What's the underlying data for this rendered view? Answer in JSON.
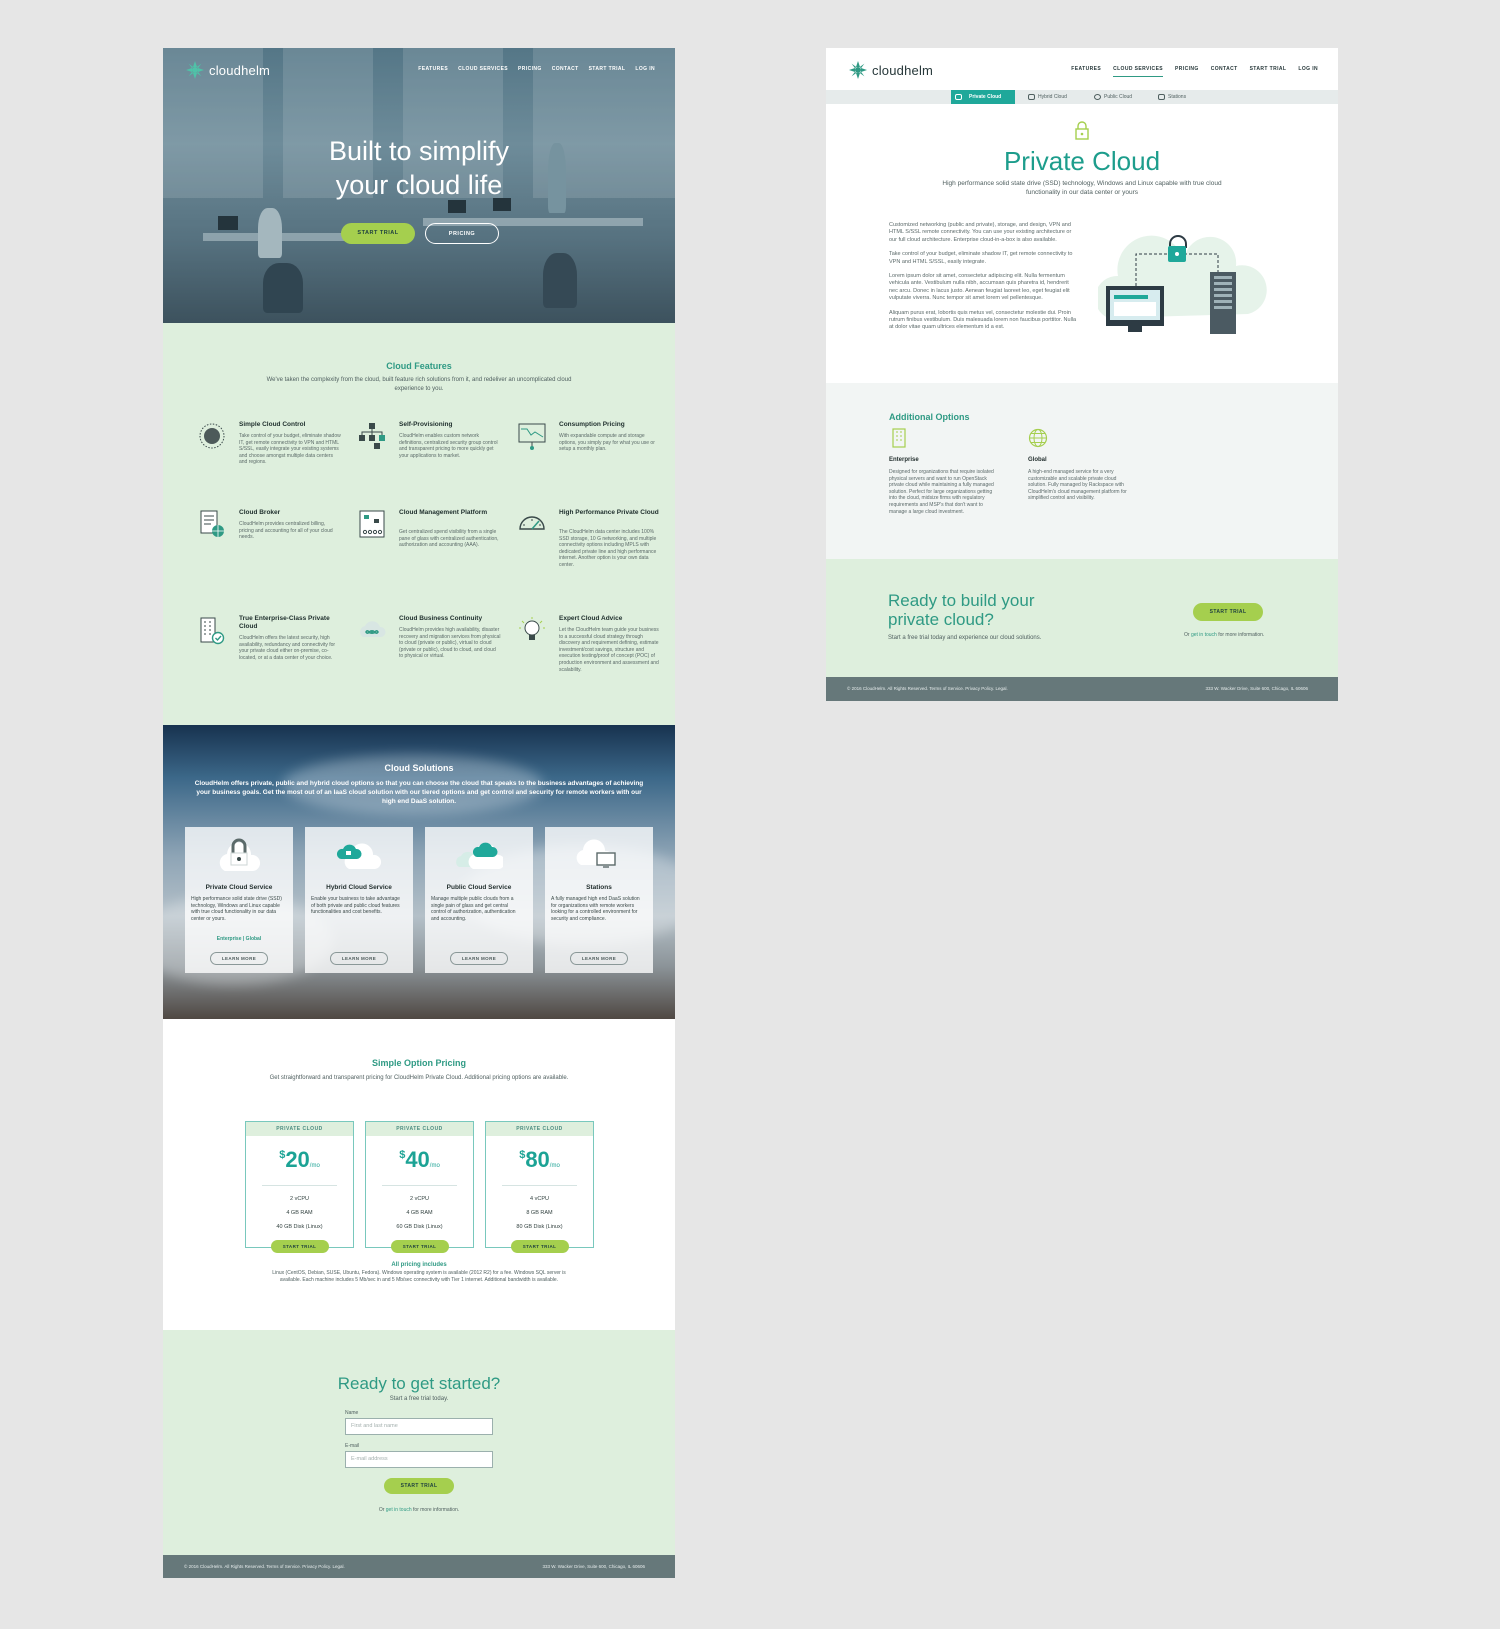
{
  "brand": {
    "name": "cloudhelm",
    "primary_color": "#2f9a84",
    "accent_color": "#a5cf4e",
    "mint_bg": "#deefdd"
  },
  "nav": [
    "FEATURES",
    "CLOUD SERVICES",
    "PRICING",
    "CONTACT",
    "START TRIAL",
    "LOG IN"
  ],
  "home": {
    "hero": {
      "title": "Built to simplify your cloud life",
      "primary_button": "START TRIAL",
      "secondary_button": "PRICING"
    },
    "features": {
      "title": "Cloud Features",
      "subtitle": "We've taken the complexity from the cloud, built feature rich solutions from it, and redeliver an uncomplicated cloud experience to you.",
      "items": [
        {
          "title": "Simple Cloud Control",
          "icon": "dial-icon",
          "desc": "Take control of your budget, eliminate shadow IT, get remote connectivity to VPN and HTML S/SSL, easily integrate your existing systems and choose amongst multiple data centers and regions."
        },
        {
          "title": "Self-Provisioning",
          "icon": "network-icon",
          "desc": "CloudHelm enables custom network definitions, centralized security group control and transparent pricing to more quickly get your applications to market."
        },
        {
          "title": "Consumption Pricing",
          "icon": "chart-icon",
          "desc": "With expandable compute and storage options, you simply pay for what you use or setup a monthly plan."
        },
        {
          "title": "Cloud Broker",
          "icon": "document-globe-icon",
          "desc": "CloudHelm provides centralized billing, pricing and accounting for all of your cloud needs."
        },
        {
          "title": "Cloud Management Platform",
          "icon": "dashboard-icon",
          "desc": "Get centralized spend visibility from a single pane of glass with centralized authentication, authorization and accounting (AAA)."
        },
        {
          "title": "High Performance Private Cloud",
          "icon": "speedometer-icon",
          "desc": "The CloudHelm data center includes 100% SSD storage, 10 G networking, and multiple connectivity options including MPLS with dedicated private line and high performance internet. Another option is your own data center."
        },
        {
          "title": "True Enterprise-Class Private Cloud",
          "icon": "building-check-icon",
          "desc": "CloudHelm offers the latest security, high availability, redundancy and connectivity for your private cloud either on-premise, co-located, or at a data center of your choice."
        },
        {
          "title": "Cloud Business Continuity",
          "icon": "cloud-infinity-icon",
          "desc": "CloudHelm provides high availability, disaster recovery and migration services from physical to cloud (private or public), virtual to cloud (private or public), cloud to cloud, and cloud to physical or virtual."
        },
        {
          "title": "Expert Cloud Advice",
          "icon": "lightbulb-icon",
          "desc": "Let the CloudHelm team guide your business to a successful cloud strategy through discovery and requirement defining, estimate investment/cost savings, structure and execution testing/proof of concept (POC) of production environment and assessment and scalability."
        }
      ]
    },
    "solutions": {
      "title": "Cloud Solutions",
      "subtitle": "CloudHelm offers private, public and hybrid cloud options so that you can choose the cloud that speaks to the business advantages of achieving your business goals. Get the most out of an IaaS cloud solution with our tiered options and get control and security for remote workers with our high end DaaS solution.",
      "cards": [
        {
          "title": "Private Cloud Service",
          "icon": "cloud-lock-icon",
          "desc": "High performance solid state drive (SSD) technology, Windows and Linux capable with true cloud functionality in our data center or yours.",
          "links": "Enterprise | Global",
          "button": "LEARN MORE"
        },
        {
          "title": "Hybrid Cloud Service",
          "icon": "hybrid-cloud-icon",
          "desc": "Enable your business to take advantage of both private and public cloud features functionalities and cost benefits.",
          "links": "",
          "button": "LEARN MORE"
        },
        {
          "title": "Public Cloud Service",
          "icon": "public-cloud-icon",
          "desc": "Manage multiple public clouds from a single pain of glass and get central control of authorization, authentication and accounting.",
          "links": "",
          "button": "LEARN MORE"
        },
        {
          "title": "Stations",
          "icon": "cloud-monitor-icon",
          "desc": "A fully managed high end DaaS solution for organizations with remote workers looking for a controlled environment for security and compliance.",
          "links": "",
          "button": "LEARN MORE"
        }
      ]
    },
    "pricing": {
      "title": "Simple Option Pricing",
      "subtitle": "Get straightforward and transparent pricing for CloudHelm Private Cloud. Additional pricing options are available.",
      "plans": [
        {
          "label": "PRIVATE CLOUD",
          "currency": "$",
          "price": "20",
          "per": "/mo",
          "cpu": "2 vCPU",
          "ram": "4 GB RAM",
          "disk": "40 GB Disk (Linux)",
          "button": "START TRIAL"
        },
        {
          "label": "PRIVATE CLOUD",
          "currency": "$",
          "price": "40",
          "per": "/mo",
          "cpu": "2 vCPU",
          "ram": "4 GB RAM",
          "disk": "60 GB Disk (Linux)",
          "button": "START TRIAL"
        },
        {
          "label": "PRIVATE CLOUD",
          "currency": "$",
          "price": "80",
          "per": "/mo",
          "cpu": "4 vCPU",
          "ram": "8 GB RAM",
          "disk": "80 GB Disk (Linux)",
          "button": "START TRIAL"
        }
      ],
      "includes_title": "All pricing includes",
      "includes_text": "Linux (CentOS, Debian, SUSE, Ubuntu, Fedora). Windows operating system is available (2012 R2) for a fee. Windows SQL server is available. Each machine includes 5 Mb/sec in and 5 Mb/sec connectivity with Tier 1 internet. Additional bandwidth is available."
    },
    "get_started": {
      "title": "Ready to get started?",
      "subtitle": "Start a free trial today.",
      "name_label": "Name",
      "name_placeholder": "First and last name",
      "email_label": "E-mail",
      "email_placeholder": "E-mail address",
      "button": "START TRIAL",
      "or_prefix": "Or",
      "or_link": "get in touch",
      "or_suffix": "for more information."
    }
  },
  "private_cloud": {
    "subnav": [
      "Private Cloud",
      "Hybrid Cloud",
      "Public Cloud",
      "Stations"
    ],
    "title": "Private Cloud",
    "subtitle": "High performance solid state drive (SSD) technology, Windows and Linux capable with true cloud functionality in our data center or yours",
    "body": [
      "Customized networking (public and private), storage, and design, VPN and HTML S/SSL remote connectivity. You can use your existing architecture or our full cloud architecture. Enterprise cloud-in-a-box is also available.",
      "Take control of your budget, eliminate shadow IT, get remote connectivity to VPN and HTML S/SSL, easily integrate.",
      "Lorem ipsum dolor sit amet, consectetur adipiscing elit. Nulla fermentum vehicula ante. Vestibulum nulla nibh, accumsan quis pharetra id, hendrerit nec arcu. Donec in lacus justo. Aenean feugiat laoreet leo, eget feugiat elit vulputate viverra. Nunc tempor sit amet lorem vel pellentesque.",
      "Aliquam purus erat, lobortis quis metus vel, consectetur molestie dui. Proin rutrum finibus vestibulum. Duis malesuada lorem non faucibus porttitor. Nulla at dolor vitae quam ultrices elementum id a est."
    ],
    "additional": {
      "title": "Additional Options",
      "options": [
        {
          "title": "Enterprise",
          "icon": "building-icon",
          "desc": "Designed for organizations that require isolated physical servers and want to run OpenStack private cloud while maintaining a fully managed solution. Perfect for large organizations getting into the cloud, midsize firms with regulatory requirements and MSP's that don't want to manage a large cloud investment."
        },
        {
          "title": "Global",
          "icon": "globe-icon",
          "desc": "A high-end managed service for a very customizable and scalable private cloud solution. Fully managed by Rackspace with CloudHelm's cloud management platform for simplified control and visibility."
        }
      ]
    },
    "ready": {
      "title": "Ready to build your private cloud?",
      "subtitle": "Start a free trial today and experience our cloud solutions.",
      "button": "START TRIAL",
      "or_prefix": "Or",
      "or_link": "get in touch",
      "or_suffix": "for more information."
    }
  },
  "footer": {
    "left": "© 2016 CloudHelm. All Rights Reserved. Terms of Service. Privacy Policy. Legal.",
    "right": "333 W. Wacker Drive, Suite 600, Chicago, IL 60606"
  }
}
